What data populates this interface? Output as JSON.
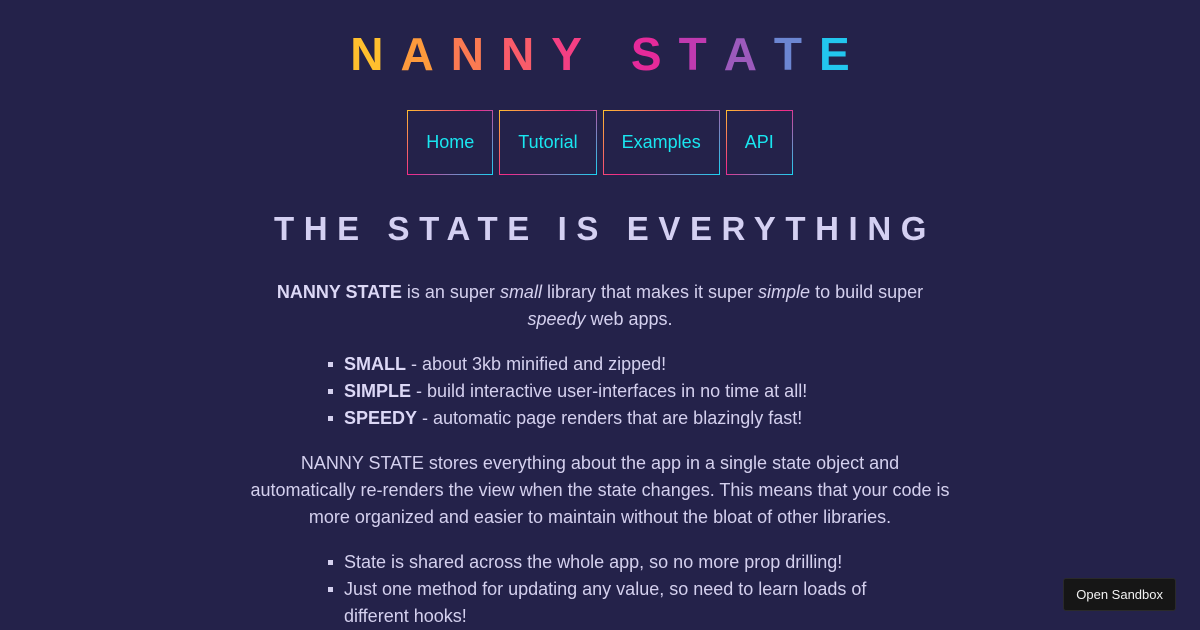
{
  "logo": {
    "letters": [
      "N",
      "A",
      "N",
      "N",
      "Y",
      " ",
      "S",
      "T",
      "A",
      "T",
      "E"
    ],
    "colors": [
      "#ffbf2e",
      "#fd9a3c",
      "#fb7a52",
      "#f95c6a",
      "#f43f83",
      "#24224a",
      "#e52a9a",
      "#c03ab0",
      "#9c5abc",
      "#6c86d2",
      "#22c6ee"
    ]
  },
  "nav": [
    {
      "label": "Home"
    },
    {
      "label": "Tutorial"
    },
    {
      "label": "Examples"
    },
    {
      "label": "API"
    }
  ],
  "headline": "THE STATE IS EVERYTHING",
  "intro": {
    "brand": "NANNY STATE",
    "t1": " is an super ",
    "e1": "small",
    "t2": " library that makes it super ",
    "e2": "simple",
    "t3": " to build super ",
    "e3": "speedy",
    "t4": " web apps."
  },
  "features": [
    {
      "term": "SMALL",
      "desc": " - about 3kb minified and zipped!"
    },
    {
      "term": "SIMPLE",
      "desc": " - build interactive user-interfaces in no time at all!"
    },
    {
      "term": "SPEEDY",
      "desc": " - automatic page renders that are blazingly fast!"
    }
  ],
  "description": "NANNY STATE stores everything about the app in a single state object and automatically re-renders the view when the state changes. This means that your code is more organized and easier to maintain without the bloat of other libraries.",
  "benefits": [
    "State is shared across the whole app, so no more prop drilling!",
    "Just one method for updating any value, so need to learn loads of different hooks!"
  ],
  "sandbox": {
    "label": "Open Sandbox"
  }
}
